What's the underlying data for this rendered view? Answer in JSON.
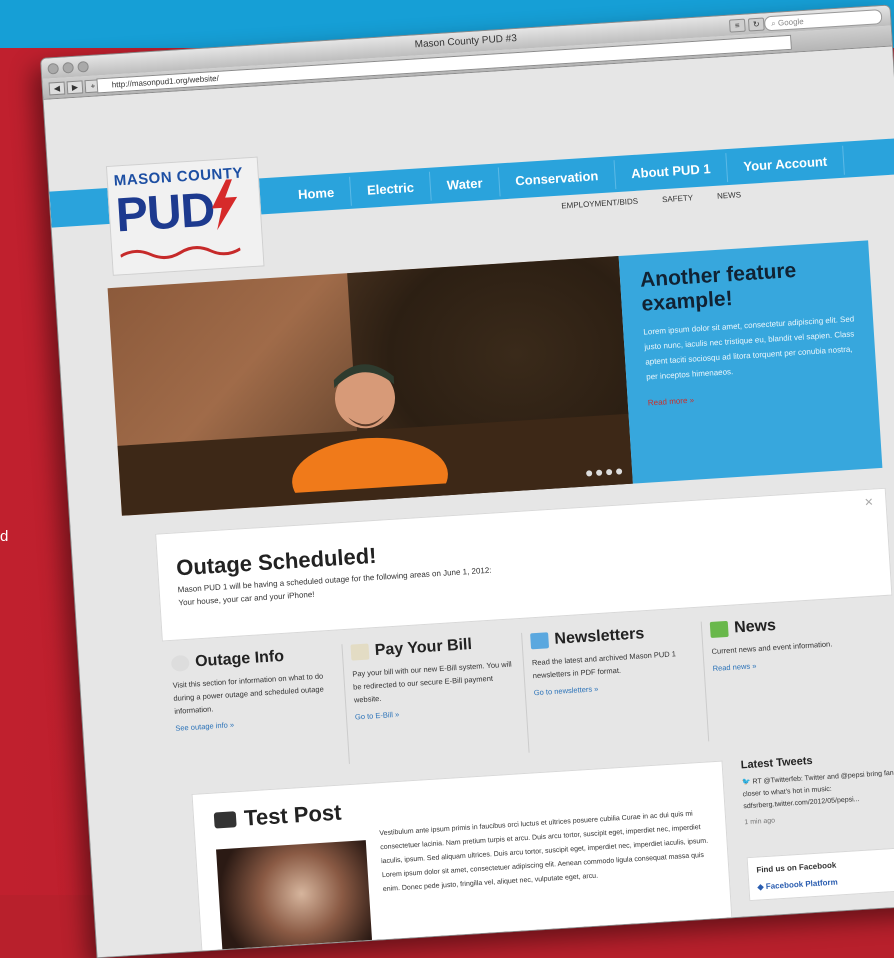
{
  "stray_text": "d",
  "browser": {
    "window_title": "Mason County PUD #3",
    "url": "http://masonpud1.org/website/",
    "search_placeholder": "Google",
    "back": "◀",
    "forward": "▶",
    "plus": "+"
  },
  "site": {
    "logo": {
      "line1": "MASON COUNTY",
      "line2": "PUD"
    },
    "menu": [
      "Home",
      "Electric",
      "Water",
      "Conservation",
      "About PUD 1",
      "Your Account"
    ],
    "submenu": [
      "EMPLOYMENT/BIDS",
      "SAFETY",
      "NEWS"
    ],
    "feature": {
      "title": "Another feature example!",
      "body": "Lorem ipsum dolor sit amet, consectetur adipiscing elit. Sed justo nunc, iaculis nec tristique eu, blandit vel sapien. Class aptent taciti sociosqu ad litora torquent per conubia nostra, per inceptos himenaeos.",
      "link": "Read more »"
    },
    "alert": {
      "title": "Outage Scheduled!",
      "line1": "Mason PUD 1 will be having a scheduled outage for the following areas on June 1, 2012:",
      "line2": "Your house, your car and your iPhone!",
      "close": "✕"
    },
    "columns": [
      {
        "title": "Outage Info",
        "text": "Visit this section for information on what to do during a power outage and scheduled outage information.",
        "link": "See outage info »"
      },
      {
        "title": "Pay Your Bill",
        "text": "Pay your bill with our new E-Bill system. You will be redirected to our secure E-Bill payment website.",
        "link": "Go to E-Bill »"
      },
      {
        "title": "Newsletters",
        "text": "Read the latest and archived Mason PUD 1 newsletters in PDF format.",
        "link": "Go to newsletters »"
      },
      {
        "title": "News",
        "text": "Current news and event information.",
        "link": "Read news »"
      }
    ],
    "post": {
      "title": "Test Post",
      "body": "Vestibulum ante ipsum primis in faucibus orci luctus et ultrices posuere cubilia Curae in ac dui quis mi consectetuer lacinia. Nam pretium turpis et arcu. Duis arcu tortor, suscipit eget, imperdiet nec, imperdiet iaculis, ipsum. Sed aliquam ultrices. Duis arcu tortor, suscipit eget, imperdiet nec, imperdiet iaculis, ipsum. Lorem ipsum dolor sit amet, consectetuer adipiscing elit. Aenean commodo ligula consequat massa quis enim. Donec pede justo, fringilla vel, aliquet nec, vulputate eget, arcu."
    },
    "tweets": {
      "title": "Latest Tweets",
      "text": "RT @Twitterfeb: Twitter and @pepsi bring fans closer to what's hot in music: sdfsrberg.twitter.com/2012/05/pepsi...",
      "time": "1 min ago"
    },
    "facebook": {
      "title": "Find us on Facebook",
      "page": "Facebook Platform"
    }
  },
  "colors": {
    "accent_blue": "#2aa3dc",
    "brand_red": "#b8202c",
    "logo_blue": "#1d3a8f"
  }
}
